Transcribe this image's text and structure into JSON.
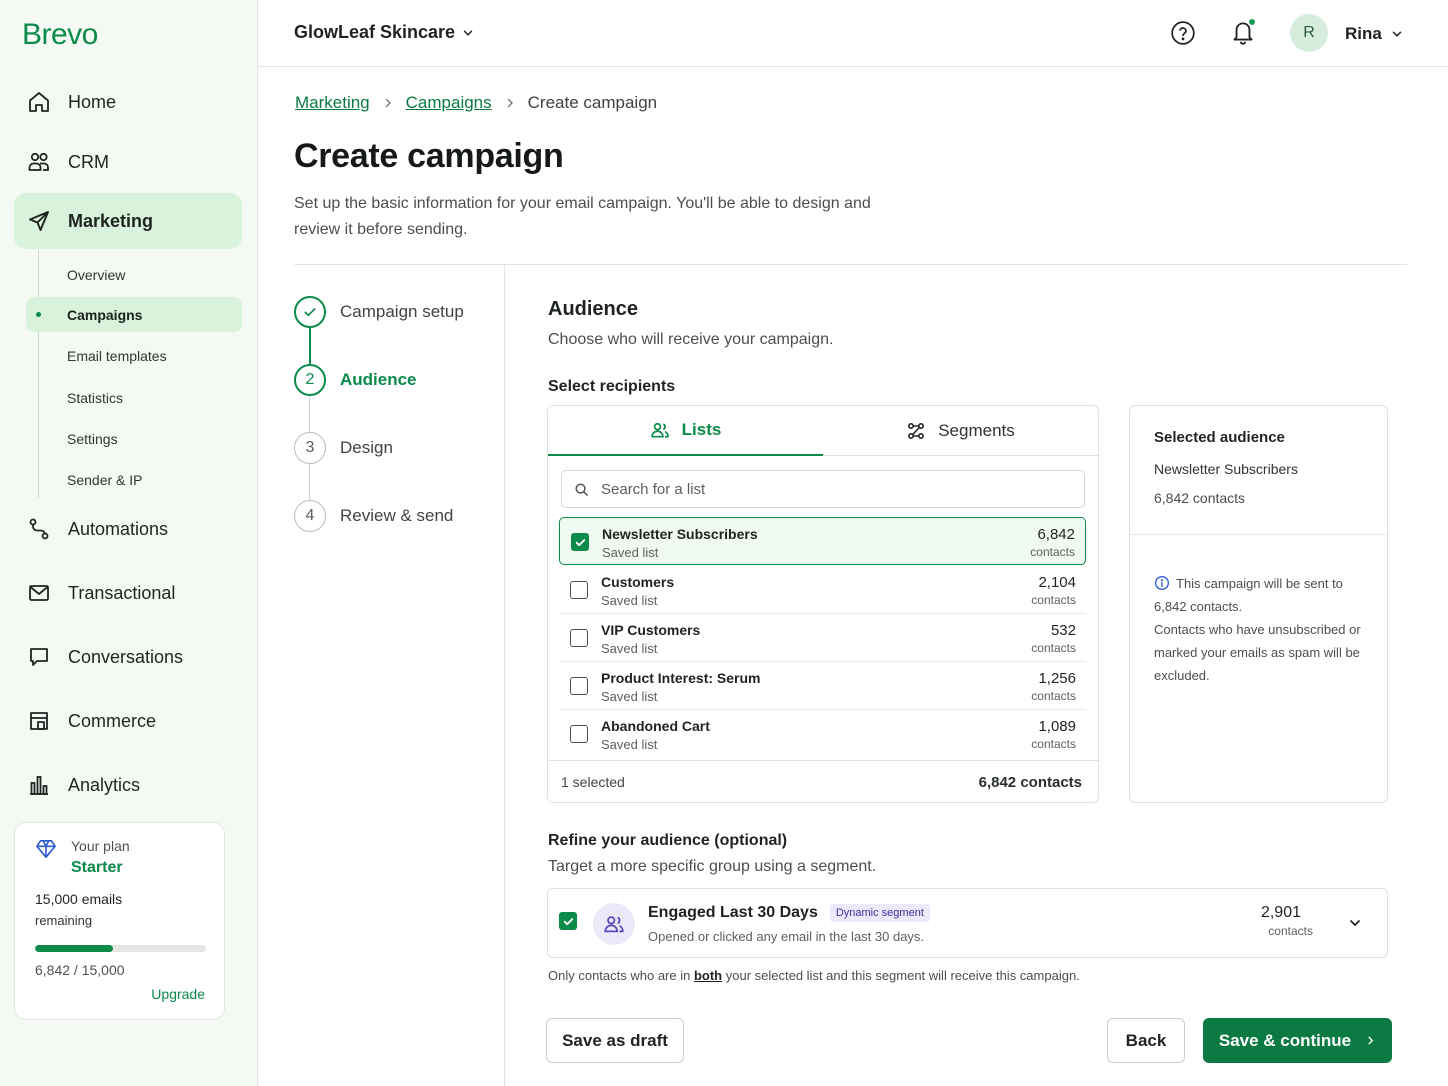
{
  "brand": "Brevo",
  "nav": {
    "home": "Home",
    "crm": "CRM",
    "marketing": "Marketing",
    "automations": "Automations",
    "transactional": "Transactional",
    "conversations": "Conversations",
    "commerce": "Commerce",
    "analytics": "Analytics"
  },
  "subnav": [
    "Overview",
    "Campaigns",
    "Email templates",
    "Statistics",
    "Settings",
    "Sender & IP"
  ],
  "plan": {
    "label": "Your plan",
    "name": "Starter",
    "emails": "15,000 emails",
    "remaining": "remaining",
    "usage": "6,842 / 15,000",
    "usage_fraction": 0.456,
    "upgrade": "Upgrade"
  },
  "topbar": {
    "workspace": "GlowLeaf Skincare",
    "avatar_initial": "R",
    "user": "Rina"
  },
  "breadcrumb": [
    "Marketing",
    "Campaigns",
    "Create campaign"
  ],
  "page": {
    "title": "Create campaign",
    "description": "Set up the basic information for your email campaign. You'll be able to design and review it before sending."
  },
  "steps": [
    {
      "num": "",
      "label": "Campaign setup",
      "state": "done"
    },
    {
      "num": "2",
      "label": "Audience",
      "state": "current"
    },
    {
      "num": "3",
      "label": "Design",
      "state": "todo"
    },
    {
      "num": "4",
      "label": "Review & send",
      "state": "todo"
    }
  ],
  "audience": {
    "title": "Audience",
    "description": "Choose who will receive your campaign.",
    "select_label": "Select recipients",
    "tabs": [
      "Lists",
      "Segments"
    ],
    "search_placeholder": "Search for a list",
    "lists": [
      {
        "name": "Newsletter Subscribers",
        "type": "Saved list",
        "count": "6,842",
        "unit": "contacts",
        "checked": true
      },
      {
        "name": "Customers",
        "type": "Saved list",
        "count": "2,104",
        "unit": "contacts",
        "checked": false
      },
      {
        "name": "VIP Customers",
        "type": "Saved list",
        "count": "532",
        "unit": "contacts",
        "checked": false
      },
      {
        "name": "Product Interest: Serum",
        "type": "Saved list",
        "count": "1,256",
        "unit": "contacts",
        "checked": false
      },
      {
        "name": "Abandoned Cart",
        "type": "Saved list",
        "count": "1,089",
        "unit": "contacts",
        "checked": false
      }
    ],
    "footer_selected": "1 selected",
    "footer_total": "6,842 contacts"
  },
  "selected_audience": {
    "title": "Selected audience",
    "name": "Newsletter Subscribers",
    "count": "6,842 contacts",
    "note_line1": "This campaign will be sent to 6,842 contacts.",
    "note_line2": "Contacts who have unsubscribed or marked your emails as spam will be excluded."
  },
  "refine": {
    "title": "Refine your audience (optional)",
    "description": "Target a more specific group using a segment.",
    "segment_name": "Engaged Last 30 Days",
    "segment_tag": "Dynamic segment",
    "segment_desc": "Opened or clicked any email in the last 30 days.",
    "segment_count": "2,901",
    "segment_unit": "contacts",
    "note_pre": "Only contacts who are in ",
    "note_bold": "both",
    "note_post": " your selected list and this segment will receive this campaign."
  },
  "buttons": {
    "draft": "Save as draft",
    "back": "Back",
    "save": "Save & continue"
  },
  "colors": {
    "accent": "#0b8a4a",
    "accent_dark": "#0b7a42",
    "sidebar_bg": "#f4faf3",
    "active_bg": "#d9f2db"
  }
}
